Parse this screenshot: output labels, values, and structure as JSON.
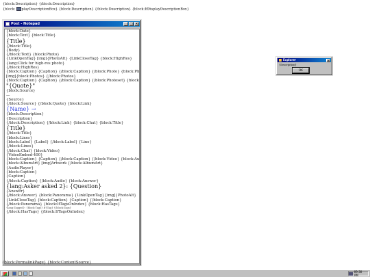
{
  "page_top": {
    "line1": "{block:Description} {/block:Description}",
    "line2_before": "{block:",
    "line2_after": "playDescriptionBox} {block:Description} {/block:Description} {block:IfDisplayDescriptionBox}"
  },
  "notepad": {
    "title": "Post - Notepad",
    "lines": [
      {
        "text": "{block:Date}",
        "style": "line"
      },
      {
        "text": "{block:Text} {block:Title}",
        "style": "line"
      },
      {
        "text": "{Title}",
        "style": "big"
      },
      {
        "text": "{/block:Title}",
        "style": "line"
      },
      {
        "text": "{Body}",
        "style": "line"
      },
      {
        "text": "{/block:Text} {block:Photo}",
        "style": "line"
      },
      {
        "text": "{LinkOpenTag} [img]{PhotoAlt} {LinkCloseTag} {block:HighRes}",
        "style": "line"
      },
      {
        "text": "{lang:Click for high-res photo}",
        "style": "line"
      },
      {
        "text": "{/block:HighRes}",
        "style": "line"
      },
      {
        "text": "{block:Caption} {Caption} {/block:Caption} {/block:Photo} {block:Photoset}",
        "style": "line"
      },
      {
        "text": "[img]{block:Photos} {/block:Photos}",
        "style": "line"
      },
      {
        "text": "{block:Caption} {Caption} {/block:Caption} {/block:Photoset} {block:Quote}",
        "style": "line"
      },
      {
        "text": "\"{Quote}\"",
        "style": "big"
      },
      {
        "text": "{block:Source}",
        "style": "line"
      },
      {
        "text": "—",
        "style": "line"
      },
      {
        "text": "{Source}",
        "style": "line"
      },
      {
        "text": "{/block:Source} {/block:Quote} {block:Link}",
        "style": "line"
      },
      {
        "text": "{Name} →",
        "style": "big blue"
      },
      {
        "text": "{block:Description}",
        "style": "line"
      },
      {
        "text": "{Description}",
        "style": "line"
      },
      {
        "text": "{/block:Description} {/block:Link} {block:Chat} {block:Title}",
        "style": "line"
      },
      {
        "text": "{Title}",
        "style": "big"
      },
      {
        "text": "{/block:Title}",
        "style": "line"
      },
      {
        "text": "{block:Lines}",
        "style": "line"
      },
      {
        "text": "{block:Label} {Label} {/block:Label} {Line}",
        "style": "line"
      },
      {
        "text": "{/block:Lines}",
        "style": "line"
      },
      {
        "text": "{/block:Chat} {block:Video}",
        "style": "line"
      },
      {
        "text": "{VideoEmbed-400}",
        "style": "line"
      },
      {
        "text": "{block:Caption} {Caption} {/block:Caption} {/block:Video} {block:Audio}",
        "style": "line"
      },
      {
        "text": "{block:AlbumArt} [img]Artwork {/block:AlbumArt}",
        "style": "line"
      },
      {
        "text": "{AudioPlayer}",
        "style": "line"
      },
      {
        "text": "{block:Caption}",
        "style": "line"
      },
      {
        "text": "{Caption}",
        "style": "line"
      },
      {
        "text": "{/block:Caption} {/block:Audio} {block:Answer}",
        "style": "line"
      },
      {
        "text": "{lang:Asker asked 2}: {Question}",
        "style": "big"
      },
      {
        "text": "{Answer}",
        "style": "line"
      },
      {
        "text": "{/block:Answer} {block:Panorama} {LinkOpenTag} [img]{PhotoAlt}",
        "style": "line"
      },
      {
        "text": "{LinkCloseTag} {block:Caption} {Caption} {/block:Caption}",
        "style": "line"
      },
      {
        "text": "{/block:Panorama} {block:IfTagsOnIndex} {block:HasTags}",
        "style": "line"
      },
      {
        "text": "{lang:Tagged}: {block:Tags} #{Tag} {/block:Tags}",
        "style": "small"
      },
      {
        "text": "{/block:HasTags} {/block:IfTagsOnIndex}",
        "style": "line"
      }
    ]
  },
  "spill_lines": [
    "{block:PermalinkPage} {block:ContentSource}"
  ],
  "explorer": {
    "title": "Explorer",
    "message": "{Description}",
    "ok_label": "OK"
  },
  "taskbar": {
    "clock": "09:30 AM"
  },
  "colors": {
    "title_active": "#000080",
    "link_blue": "#3344dd",
    "chrome": "#c0c0c0"
  }
}
